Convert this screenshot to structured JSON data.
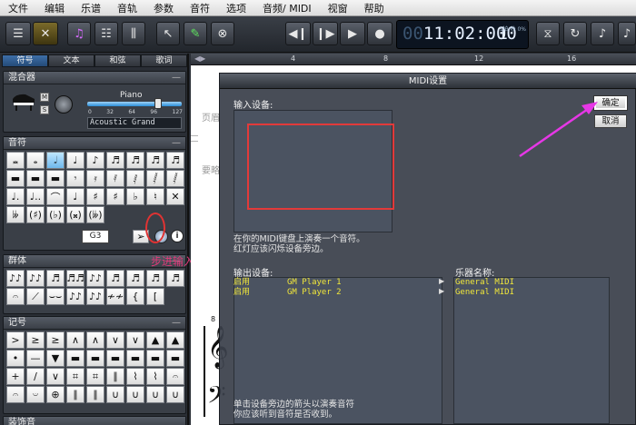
{
  "menu": [
    "文件",
    "编辑",
    "乐谱",
    "音轨",
    "参数",
    "音符",
    "选项",
    "音频/ MIDI",
    "视窗",
    "帮助"
  ],
  "toolbar": {
    "time": "11:02:000",
    "time_dim": "00",
    "tempo": "1",
    "tempo_small": "1拍/秒 0%",
    "icons": [
      "track-view-icon",
      "tools-icon",
      "notes-icon",
      "list-icon",
      "mixer-icon",
      "pointer-icon",
      "pencil-icon",
      "cancel-icon",
      "rewind-icon",
      "back-icon",
      "play-icon",
      "record-icon",
      "metronome-icon",
      "loop-icon",
      "note-icon"
    ]
  },
  "left_tabs": [
    "符号",
    "文本",
    "和弦",
    "歌词"
  ],
  "mixer": {
    "title": "混合器",
    "instrument_label": "Piano",
    "instrument_name": "Acoustic Grand",
    "m": "M",
    "s": "S",
    "volume_fraction": 0.77,
    "scale": [
      "0",
      "32",
      "64",
      "96",
      "127"
    ]
  },
  "notes": {
    "title": "音符",
    "row1": [
      "𝅜",
      "𝅝",
      "𝅗𝅥",
      "♩",
      "♪",
      "♬",
      "♬",
      "♬",
      "♬"
    ],
    "row2": [
      "▬",
      "▬",
      "▬",
      "𝄾",
      "𝄿",
      "𝅀",
      "𝅁",
      "𝅂",
      "𝅂"
    ],
    "row3": [
      "♩.",
      "♩..",
      "⌒",
      "♩",
      "♯",
      "♯",
      "♭",
      "♮",
      "✕"
    ],
    "row4": [
      "𝄫",
      "(♯)",
      "(♭)",
      "(𝄪)",
      "(𝄫)",
      "",
      "",
      "",
      ""
    ],
    "pitch": "G3",
    "info": "i",
    "step_input_label": "步进输入"
  },
  "groups": {
    "title": "群体",
    "row1": [
      "♪♪",
      "♪♪",
      "♬",
      "♬♬",
      "♪♪",
      "♬",
      "♬",
      "♬",
      "♬"
    ],
    "row2": [
      "𝄐",
      "⟋",
      "⌣⌣",
      "♪♪",
      "♪♪",
      "≁≁",
      "{",
      "[",
      ""
    ]
  },
  "marks": {
    "title": "记号",
    "row1": [
      ">",
      "≥",
      "≥",
      "∧",
      "∧",
      "∨",
      "∨",
      "▲",
      "▲"
    ],
    "row2": [
      "•",
      "—",
      "▼",
      "▬",
      "▬",
      "▬",
      "▬",
      "▬",
      "▬"
    ],
    "row3": [
      "+",
      "∕",
      "∨",
      "⌗",
      "⌗",
      "∥",
      "⌇",
      "⌇",
      "𝄐"
    ],
    "row4": [
      "𝄐",
      "𝄑",
      "⊕",
      "∥",
      "∥",
      "∪",
      "∪",
      "∪",
      "∪"
    ]
  },
  "ornaments": {
    "title": "装饰音"
  },
  "ruler": [
    "4",
    "8",
    "12",
    "16"
  ],
  "dialog": {
    "title": "MIDI设置",
    "input_label": "输入设备:",
    "input_hint_1": "在你的MIDI键盘上演奏一个音符。",
    "input_hint_2": "红灯应该闪烁设备旁边。",
    "output_label": "输出设备:",
    "instrument_label": "乐器名称:",
    "outputs": [
      {
        "state": "启用",
        "name": "GM Player 1",
        "instrument": "General MIDI"
      },
      {
        "state": "启用",
        "name": "GM Player 2",
        "instrument": "General MIDI"
      }
    ],
    "bottom_hint_1": "单击设备旁边的箭头以演奏音符",
    "bottom_hint_2": "你应该听到音符是否收到。",
    "ok": "确定",
    "cancel": "取消"
  },
  "score_bar_number": "8",
  "bg_text_1": "页眉",
  "bg_text_2": "要略"
}
